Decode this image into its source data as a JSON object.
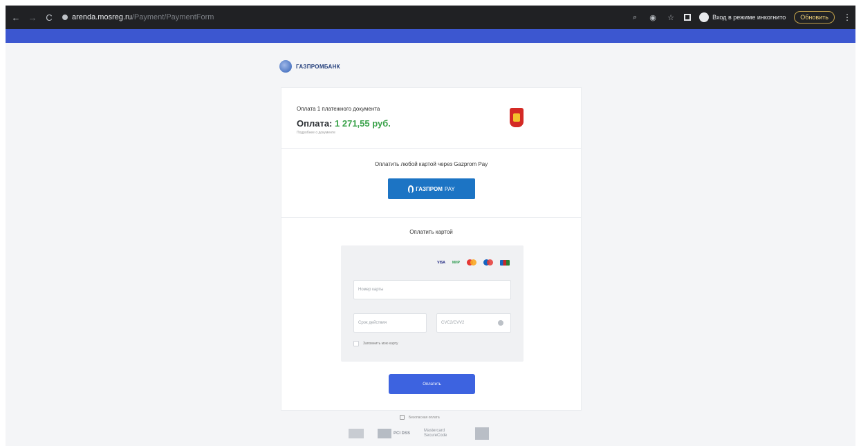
{
  "browser": {
    "back_icon": "←",
    "forward_icon": "→",
    "reload_icon": "C",
    "url_host": "arenda.mosreg.ru",
    "url_path": "/Payment/PaymentForm",
    "profile_label": "Вход в режиме инкогнито",
    "update_label": "Обновить",
    "menu_icon": "⋮"
  },
  "bank": {
    "name": "ГАЗПРОМБАНК"
  },
  "payment": {
    "document_title": "Оплата 1 платежного документа",
    "pay_label": "Оплата:",
    "amount": "1 271,55 руб.",
    "note": "Подробнее о документе"
  },
  "gazprom_pay": {
    "title": "Оплатить любой картой через Gazprom Pay",
    "button_brand": "ГАЗПРОМ",
    "button_suffix": "PAY"
  },
  "card_payment": {
    "title": "Оплатить картой",
    "logos": [
      "VISA",
      "МИР",
      "Mastercard",
      "Maestro",
      "JCB"
    ],
    "card_number_placeholder": "Номер карты",
    "expiry_placeholder": "Срок действия",
    "cvv_placeholder": "CVC2/CVV2",
    "remember_label": "Запомнить мою карту",
    "submit_label": "Оплатить"
  },
  "footer": {
    "secure_label": "Безопасная оплата",
    "badge_pci": "PCI DSS",
    "badge_mc": "Mastercard SecureCode"
  }
}
